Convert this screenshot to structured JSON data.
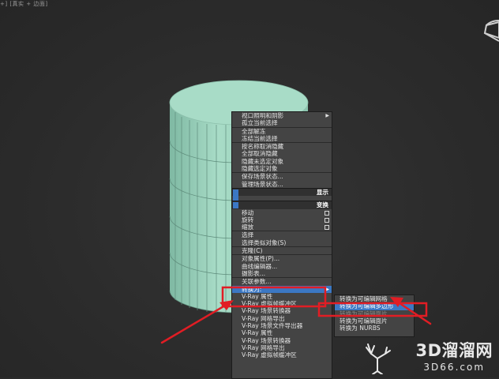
{
  "viewport": {
    "label": "+] [真实 + 边面]",
    "colors": {
      "background": "#2b2b2b",
      "object": "#a8dcc7",
      "highlight": "#3b78c4",
      "annotation": "#e11d24"
    }
  },
  "menu": {
    "items": [
      {
        "label": "视口照明和阴影",
        "submenu": true
      },
      {
        "label": "孤立当前选择"
      },
      {
        "label": "全部解冻",
        "sep": true
      },
      {
        "label": "冻结当前选择"
      },
      {
        "label": "按名称取消隐藏",
        "sep": true
      },
      {
        "label": "全部取消隐藏"
      },
      {
        "label": "隐藏未选定对象"
      },
      {
        "label": "隐藏选定对象"
      },
      {
        "label": "保存场景状态...",
        "sep": true
      },
      {
        "label": "管理场景状态..."
      }
    ],
    "quad_display": "显示",
    "quad_transform": "变换",
    "transform_items": [
      {
        "label": "移动",
        "box": true
      },
      {
        "label": "旋转",
        "box": true
      },
      {
        "label": "缩放",
        "box": true
      },
      {
        "label": "选择",
        "sep": true
      },
      {
        "label": "选择类似对象(S)"
      },
      {
        "label": "克隆(C)",
        "sep": true
      },
      {
        "label": "对象属性(P)...",
        "sep": true
      },
      {
        "label": "曲线编辑器..."
      },
      {
        "label": "摄影表..."
      },
      {
        "label": "关联参数...",
        "sep": true
      },
      {
        "label": "转换为:",
        "highlight": true,
        "submenu": true
      }
    ],
    "vray_items": [
      {
        "label": "V-Ray 属性"
      },
      {
        "label": "V-Ray 虚拟帧缓冲区"
      },
      {
        "label": "V-Ray 场景转换器"
      },
      {
        "label": "V-Ray 网格导出"
      },
      {
        "label": "V-Ray 场景文件导出器"
      },
      {
        "label": "V-Ray 属性"
      },
      {
        "label": "V-Ray 场景转换器"
      },
      {
        "label": "V-Ray 网格导出"
      },
      {
        "label": "V-Ray 虚拟帧缓冲区"
      }
    ]
  },
  "submenu": {
    "items": [
      {
        "label": "转换为可编辑网格"
      },
      {
        "label": "转换为可编辑多边形",
        "highlight": true
      },
      {
        "label": "转换为可编辑面片",
        "dim": true
      },
      {
        "label": "转换为可编辑面片"
      },
      {
        "label": "转换为 NURBS"
      }
    ]
  },
  "watermark": {
    "text": "3D溜溜网",
    "url": "3D66.com"
  }
}
